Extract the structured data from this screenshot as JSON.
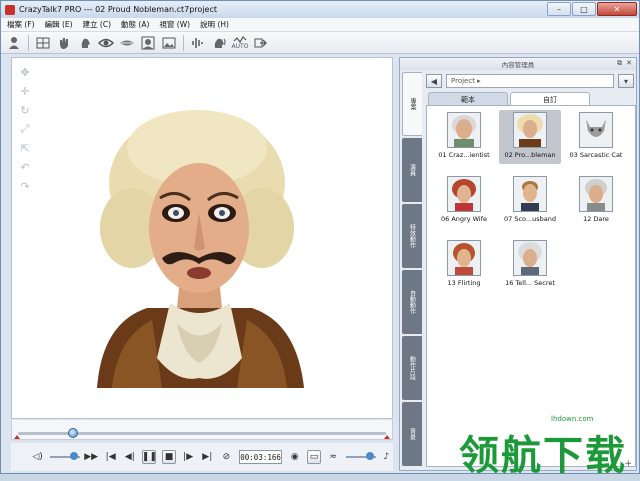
{
  "window": {
    "title": "CrazyTalk7 PRO --- 02 Proud Nobleman.ct7project",
    "min_label": "–",
    "max_label": "□",
    "close_label": "✕"
  },
  "menu": [
    "檔案 (F)",
    "編輯 (E)",
    "建立 (C)",
    "動態 (A)",
    "視窗 (W)",
    "說明 (H)"
  ],
  "toolbar": {
    "icons": [
      "person-icon",
      "grid-icon",
      "hand-icon",
      "head-icon",
      "eye-icon",
      "mouth-icon",
      "face-frame-icon",
      "image-icon",
      "audio-wave-icon",
      "voice-icon",
      "auto-icon",
      "export-icon"
    ],
    "auto_label": "AUTO"
  },
  "sidetools": [
    "move-icon",
    "pan-icon",
    "rotate-icon",
    "scale-icon",
    "fit-icon",
    "undo-icon",
    "redo-icon"
  ],
  "timeline": {
    "position": 0.15
  },
  "transport": {
    "timecode": "00:03:166"
  },
  "panel": {
    "header": "內容管理員",
    "vertical_tabs": [
      "專案",
      "演員",
      "特效動作",
      "自動動作",
      "動作片段",
      "背景"
    ],
    "breadcrumb": "Project ▸",
    "subtabs": [
      "範本",
      "自訂"
    ],
    "items": [
      {
        "label": "01 Craz...ientist",
        "selected": false
      },
      {
        "label": "02 Pro...bleman",
        "selected": true
      },
      {
        "label": "03 Sarcastic Cat",
        "selected": false
      },
      {
        "label": "06 Angry Wife",
        "selected": false
      },
      {
        "label": "07 Sco...usband",
        "selected": false
      },
      {
        "label": "12 Dare",
        "selected": false
      },
      {
        "label": "13 Flirting",
        "selected": false
      },
      {
        "label": "16 Tell... Secret",
        "selected": false
      }
    ]
  },
  "watermark": {
    "text": "领航下载",
    "url": "lhdown.com"
  }
}
